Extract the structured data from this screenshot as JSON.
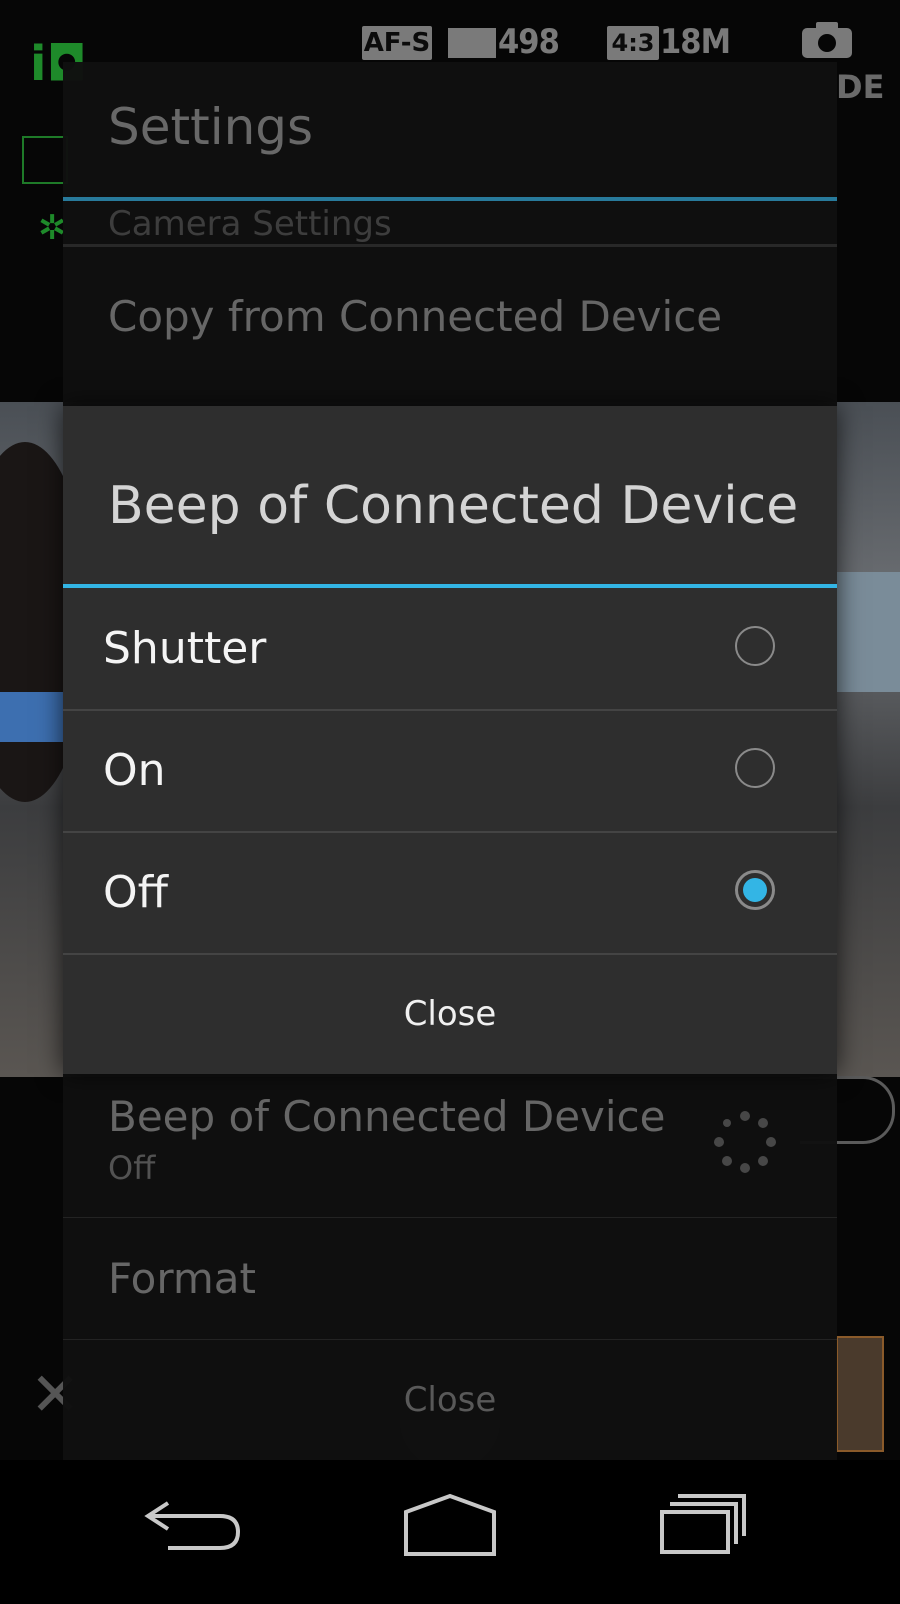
{
  "camera_status": {
    "af_mode": "AF-S",
    "shots_remaining": "498",
    "aspect_ratio": "4:3",
    "image_size": "18M",
    "mode_label": "DE"
  },
  "settings": {
    "title": "Settings",
    "section_header": "Camera Settings",
    "item_copy": "Copy from Connected Device",
    "item_beep": "Beep of Connected Device",
    "item_beep_value": "Off",
    "item_format": "Format",
    "close_label": "Close"
  },
  "beep_dialog": {
    "title": "Beep of Connected Device",
    "options": [
      {
        "label": "Shutter",
        "selected": false
      },
      {
        "label": "On",
        "selected": false
      },
      {
        "label": "Off",
        "selected": true
      }
    ],
    "close_label": "Close",
    "accent_color": "#33b5e5"
  },
  "nav_bar": {
    "icons": [
      "back-icon",
      "home-icon",
      "recent-apps-icon"
    ]
  }
}
